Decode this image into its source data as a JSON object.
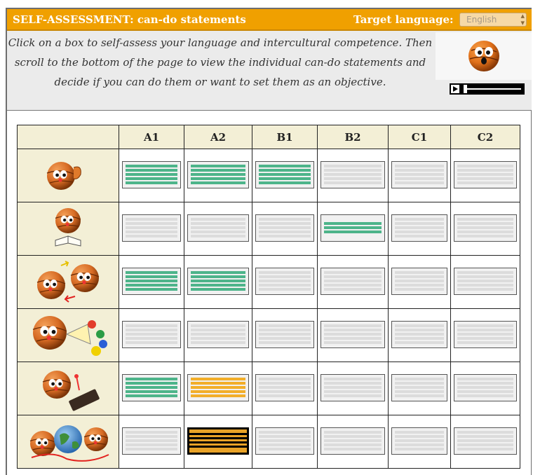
{
  "header": {
    "title": "SELF-ASSESSMENT: can-do statements",
    "target_language_label": "Target language:",
    "target_language_value": "English"
  },
  "instructions": "Click on a box to self-assess your language and intercultural competence. Then scroll to the bottom of the page to view the individual can-do statements and decide if you can do them or want to set them as an objective.",
  "levels": [
    "A1",
    "A2",
    "B1",
    "B2",
    "C1",
    "C2"
  ],
  "skills": [
    {
      "icon": "listening-icon",
      "cells": [
        "full-green",
        "full-green",
        "full-green",
        "empty",
        "empty",
        "empty"
      ]
    },
    {
      "icon": "reading-icon",
      "cells": [
        "empty",
        "empty",
        "empty",
        "partial-green",
        "empty",
        "empty"
      ]
    },
    {
      "icon": "spoken-interaction-icon",
      "cells": [
        "full-green",
        "full-green",
        "empty",
        "empty",
        "empty",
        "empty"
      ]
    },
    {
      "icon": "spoken-production-icon",
      "cells": [
        "empty",
        "empty",
        "empty",
        "empty",
        "empty",
        "empty"
      ]
    },
    {
      "icon": "writing-icon",
      "cells": [
        "full-green",
        "full-orange",
        "empty",
        "empty",
        "empty",
        "empty"
      ]
    },
    {
      "icon": "intercultural-icon",
      "cells": [
        "empty",
        "selected-orange",
        "empty",
        "empty",
        "empty",
        "empty"
      ]
    }
  ],
  "colors": {
    "header_bg": "#f0a000",
    "can_do": "#4db48a",
    "objective": "#f2ae2a",
    "empty_line": "#dcdcdc",
    "icon_cell_bg": "#f3efd6"
  },
  "media_player": {
    "progress": 0.03
  }
}
